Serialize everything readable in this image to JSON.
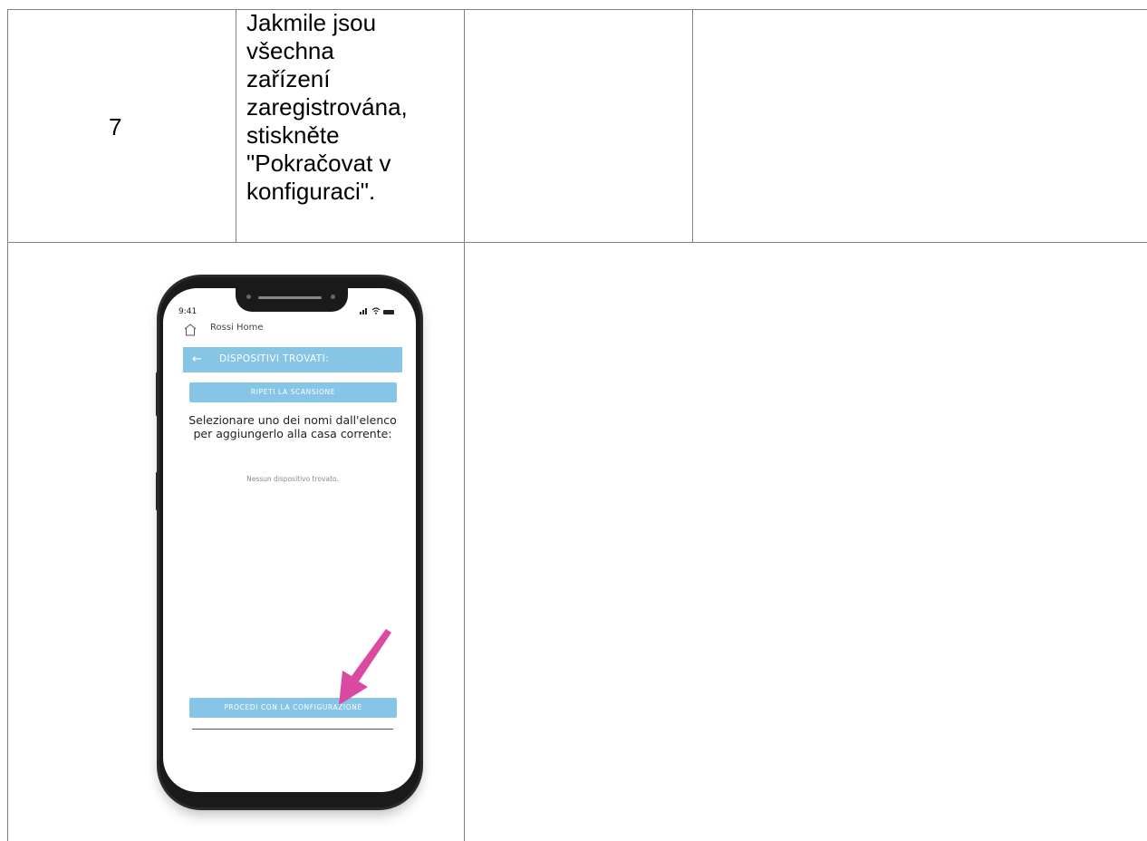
{
  "table": {
    "step_number": "7",
    "instruction": "Jakmile jsou\nvšechna\nzařízení\nzaregistrována,\nstiskněte\n\"Pokračovat v\nkonfiguraci\"."
  },
  "phone_screen": {
    "status_time": "9:41",
    "status_icons": [
      "signal-icon",
      "wifi-icon",
      "battery-icon"
    ],
    "home_title": "Rossi Home",
    "header_title": "DISPOSITIVI TROVATI:",
    "rescan_label": "RIPETI LA SCANSIONE",
    "select_message": "Selezionare uno dei nomi dall'elenco per aggiungerlo alla casa corrente:",
    "no_device_message": "Nessun dispositivo trovato.",
    "proceed_label": "PROCEDI CON LA CONFIGURAZIONE",
    "accent_color": "#86c5e6",
    "pointer_color": "#d94aa0"
  }
}
